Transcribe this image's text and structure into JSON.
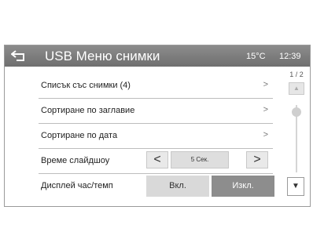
{
  "header": {
    "title": "USB Меню снимки",
    "temperature": "15°C",
    "time": "12:39"
  },
  "menu": {
    "rows": [
      {
        "label": "Списък със снимки (4)",
        "arrow": ">"
      },
      {
        "label": "Сортиране по заглавие",
        "arrow": ">"
      },
      {
        "label": "Сортиране по дата",
        "arrow": ">"
      }
    ],
    "slideshow": {
      "label": "Време слайдшоу",
      "prev": "<",
      "value": "5 Сек.",
      "next": ">"
    },
    "clock_display": {
      "label": "Дисплей час/темп",
      "on": "Вкл.",
      "off": "Изкл."
    }
  },
  "scroll": {
    "page": "1 / 2",
    "up": "▲",
    "down": "▼"
  },
  "colors": {
    "header_bg": "#7a7a7a",
    "selected_bg": "#8d8d8d",
    "button_bg": "#d9d9d9"
  }
}
